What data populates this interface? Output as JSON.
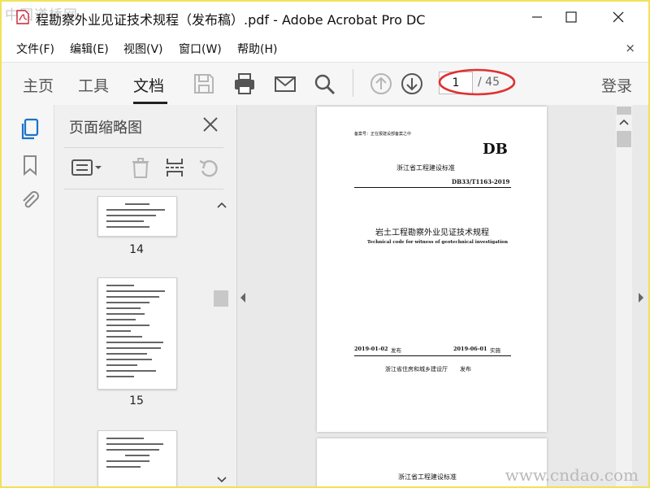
{
  "watermark_top": "中国道桥网",
  "watermark_bottom": "www.cndao.com",
  "window": {
    "title": "程勘察外业见证技术规程（发布稿）.pdf - Adobe Acrobat Pro DC"
  },
  "menu": {
    "items": [
      "文件(F)",
      "编辑(E)",
      "视图(V)",
      "窗口(W)",
      "帮助(H)"
    ],
    "close": "×"
  },
  "toolbar": {
    "tabs": [
      "主页",
      "工具",
      "文档"
    ],
    "active_tab": "文档",
    "page_current": "1",
    "page_total": "/ 45",
    "login": "登录",
    "highlight_color": "#e03030"
  },
  "panel": {
    "title": "页面缩略图",
    "thumbs": [
      {
        "label": "14"
      },
      {
        "label": "15"
      }
    ]
  },
  "document": {
    "page1": {
      "record_no": "备案号：正在报建设部备案之中",
      "db_mark": "DB",
      "province_std": "浙江省工程建设标准",
      "std_code": "DB33/T1163-2019",
      "title_cn": "岩土工程勘察外业见证技术规程",
      "title_en": "Technical code for witness of geotechnical investigation",
      "publish_date": "2019-01-02",
      "publish_word": "发布",
      "impl_date": "2019-06-01",
      "impl_word": "实施",
      "issuer": "浙江省住房和城乡建设厅",
      "issuer_word": "发布"
    },
    "page2": {
      "heading": "浙江省工程建设标准"
    }
  },
  "colors": {
    "frame_border": "#f2e15a",
    "active_icon": "#1a73c9"
  }
}
